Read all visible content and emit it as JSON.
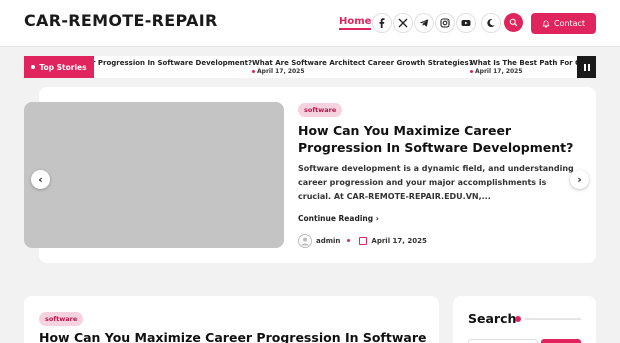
{
  "header": {
    "logo": "CAR-REMOTE-REPAIR",
    "nav_home": "Home",
    "social_icons": [
      "facebook-icon",
      "x-icon",
      "telegram-icon",
      "instagram-icon",
      "youtube-icon"
    ],
    "contact_label": "Contact"
  },
  "ticker": {
    "label": "Top Stories",
    "items": [
      {
        "title": "r Progression In Software Development?",
        "date": ""
      },
      {
        "title": "What Are Software Architect Career Growth Strategies?",
        "date": "April 17, 2025"
      },
      {
        "title": "What Is The Best Path For Ca",
        "date": "April 17, 2025"
      }
    ]
  },
  "featured": {
    "category": "software",
    "title": "How Can You Maximize Career Progression In Software Development?",
    "excerpt": "Software development is a dynamic field, and understanding career progression and your major accomplishments is crucial. At CAR-REMOTE-REPAIR.EDU.VN,...",
    "continue_label": "Continue Reading",
    "author": "admin",
    "date": "April 17, 2025"
  },
  "post": {
    "category": "software",
    "title": "How Can You Maximize Career Progression In Software"
  },
  "sidebar": {
    "search_title": "Search"
  },
  "colors": {
    "accent": "#e0245e",
    "badge_bg": "#f6d2de",
    "page_bg": "#f2f2f3"
  }
}
